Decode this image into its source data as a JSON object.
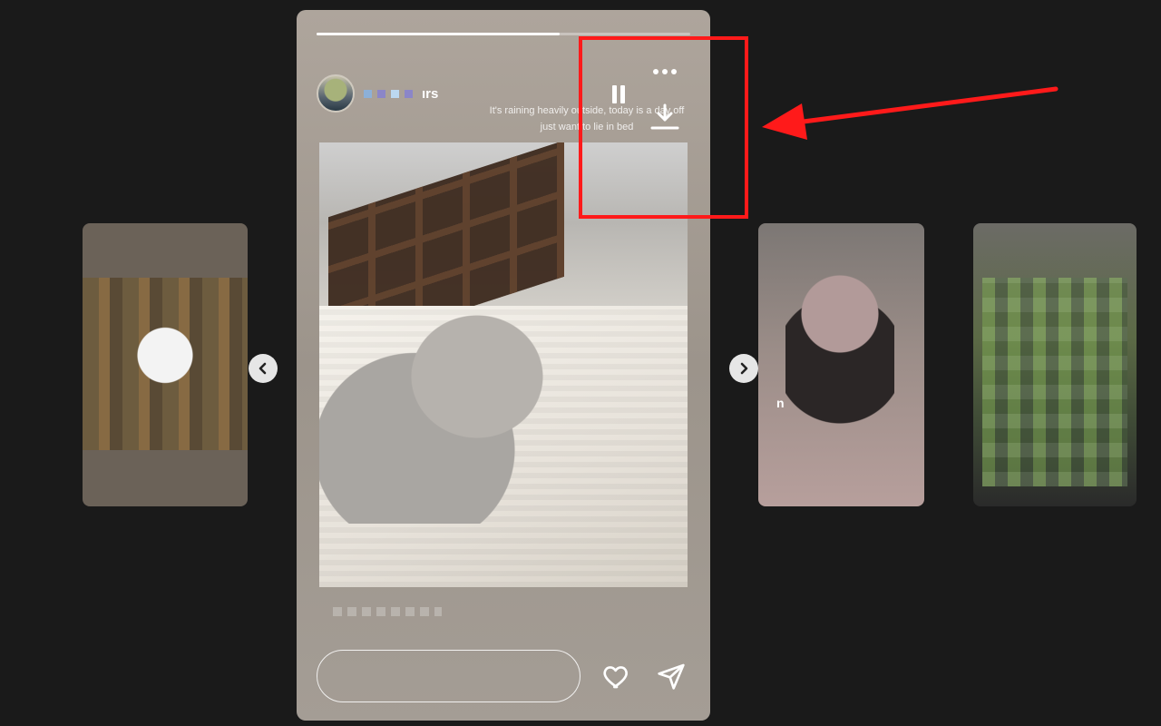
{
  "story": {
    "username_suffix": "ırs",
    "caption": "It's raining heavily outside, today is a day off\njust want to lie in bed",
    "progress": 0.65,
    "reply_placeholder": ""
  },
  "icons": {
    "more": "more-dots-icon",
    "pause": "pause-icon",
    "download": "download-icon",
    "like": "heart-icon",
    "share": "send-icon",
    "prev": "chevron-left-icon",
    "next": "chevron-right-icon"
  },
  "previews": {
    "right_1_caption": "n"
  },
  "colors": {
    "background": "#1a1a1a",
    "annotation": "#ff1a1a",
    "story_bg": "#aea59c"
  }
}
